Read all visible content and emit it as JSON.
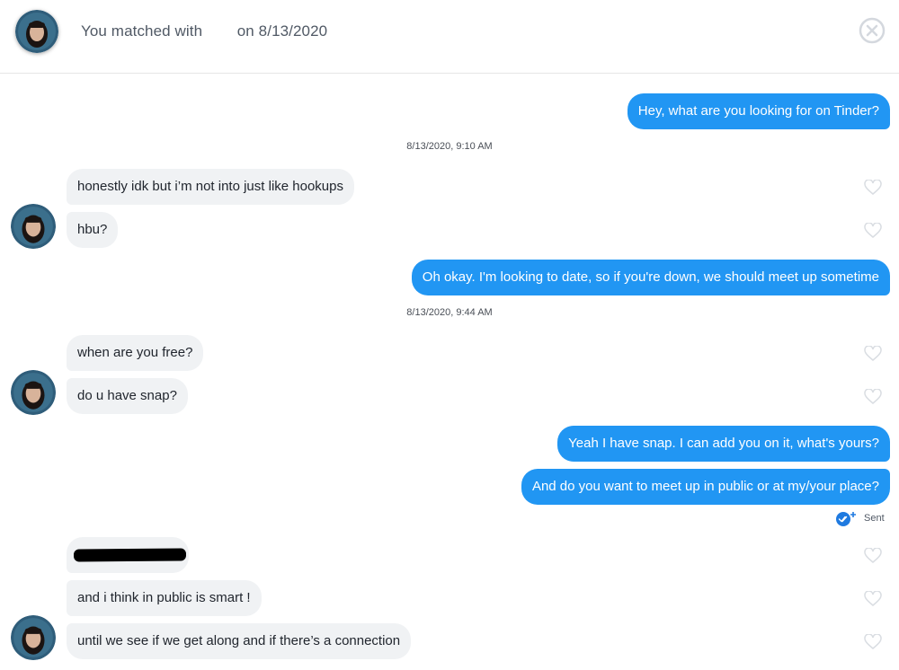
{
  "header": {
    "title": "You matched with        on 8/13/2020",
    "close_icon": "close-circle-icon",
    "avatar_icon": "match-avatar"
  },
  "messages": [
    {
      "from": "me",
      "text": "Hey, what are you looking for on Tinder?"
    },
    {
      "timestamp": "8/13/2020, 9:10 AM"
    },
    {
      "from": "match",
      "text": "honestly idk but i’m not into just like hookups"
    },
    {
      "from": "match",
      "text": "hbu?"
    },
    {
      "from": "me",
      "text": "Oh okay. I'm looking to date, so if you're down, we should meet up sometime"
    },
    {
      "timestamp": "8/13/2020, 9:44 AM"
    },
    {
      "from": "match",
      "text": "when are you free?"
    },
    {
      "from": "match",
      "text": "do u have snap?"
    },
    {
      "from": "me",
      "text": "Yeah I have snap. I can add you on it, what's yours?"
    },
    {
      "from": "me",
      "text": "And do you want to meet up in public or at my/your place?"
    },
    {
      "from": "match",
      "text": "",
      "redacted": true
    },
    {
      "from": "match",
      "text": "and i think in public is smart !"
    },
    {
      "from": "match",
      "text": "until we see if we get along and if there’s a connection"
    }
  ],
  "status": {
    "sent_label": "Sent",
    "icon": "double-check-icon"
  },
  "colors": {
    "outgoing": "#2196f3",
    "incoming": "#f0f2f4",
    "text": "#21262e"
  }
}
